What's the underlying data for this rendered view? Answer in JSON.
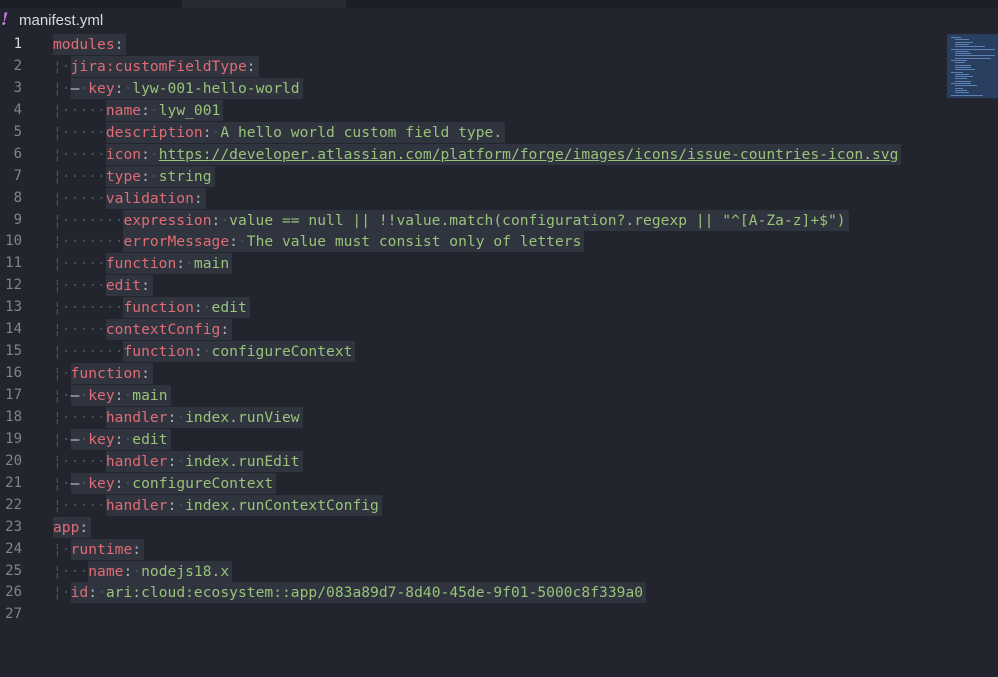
{
  "tab": {
    "warning_icon": "!",
    "filename": "manifest.yml"
  },
  "colors": {
    "background": "#22252e",
    "key": "#e06c75",
    "value": "#98c379",
    "line_number": "#7f848e"
  },
  "lines": [
    {
      "n": "1",
      "indent": 0,
      "dash": false,
      "key": "modules",
      "value": ""
    },
    {
      "n": "2",
      "indent": 1,
      "dash": false,
      "key": "jira:customFieldType",
      "value": ""
    },
    {
      "n": "3",
      "indent": 2,
      "dash": true,
      "key": "key",
      "value": "lyw-001-hello-world"
    },
    {
      "n": "4",
      "indent": 3,
      "dash": false,
      "key": "name",
      "value": "lyw_001"
    },
    {
      "n": "5",
      "indent": 3,
      "dash": false,
      "key": "description",
      "value": "A hello world custom field type."
    },
    {
      "n": "6",
      "indent": 3,
      "dash": false,
      "key": "icon",
      "value": "https://developer.atlassian.com/platform/forge/images/icons/issue-countries-icon.svg",
      "link": true
    },
    {
      "n": "7",
      "indent": 3,
      "dash": false,
      "key": "type",
      "value": "string"
    },
    {
      "n": "8",
      "indent": 3,
      "dash": false,
      "key": "validation",
      "value": ""
    },
    {
      "n": "9",
      "indent": 4,
      "dash": false,
      "key": "expression",
      "value": "value == null || !!value.match(configuration?.regexp || \"^[A-Za-z]+$\")"
    },
    {
      "n": "10",
      "indent": 4,
      "dash": false,
      "key": "errorMessage",
      "value": "The value must consist only of letters"
    },
    {
      "n": "11",
      "indent": 3,
      "dash": false,
      "key": "function",
      "value": "main"
    },
    {
      "n": "12",
      "indent": 3,
      "dash": false,
      "key": "edit",
      "value": ""
    },
    {
      "n": "13",
      "indent": 4,
      "dash": false,
      "key": "function",
      "value": "edit"
    },
    {
      "n": "14",
      "indent": 3,
      "dash": false,
      "key": "contextConfig",
      "value": ""
    },
    {
      "n": "15",
      "indent": 4,
      "dash": false,
      "key": "function",
      "value": "configureContext"
    },
    {
      "n": "16",
      "indent": 1,
      "dash": false,
      "key": "function",
      "value": ""
    },
    {
      "n": "17",
      "indent": 2,
      "dash": true,
      "key": "key",
      "value": "main"
    },
    {
      "n": "18",
      "indent": 3,
      "dash": false,
      "key": "handler",
      "value": "index.runView"
    },
    {
      "n": "19",
      "indent": 2,
      "dash": true,
      "key": "key",
      "value": "edit"
    },
    {
      "n": "20",
      "indent": 3,
      "dash": false,
      "key": "handler",
      "value": "index.runEdit"
    },
    {
      "n": "21",
      "indent": 2,
      "dash": true,
      "key": "key",
      "value": "configureContext"
    },
    {
      "n": "22",
      "indent": 3,
      "dash": false,
      "key": "handler",
      "value": "index.runContextConfig"
    },
    {
      "n": "23",
      "indent": 0,
      "dash": false,
      "key": "app",
      "value": ""
    },
    {
      "n": "24",
      "indent": 1,
      "dash": false,
      "key": "runtime",
      "value": ""
    },
    {
      "n": "25",
      "indent": 2,
      "dash": false,
      "key": "name",
      "value": "nodejs18.x"
    },
    {
      "n": "26",
      "indent": 1,
      "dash": false,
      "key": "id",
      "value": "ari:cloud:ecosystem::app/083a89d7-8d40-45de-9f01-5000c8f339a0"
    },
    {
      "n": "27",
      "indent": 0,
      "dash": false,
      "key": "",
      "value": ""
    }
  ]
}
